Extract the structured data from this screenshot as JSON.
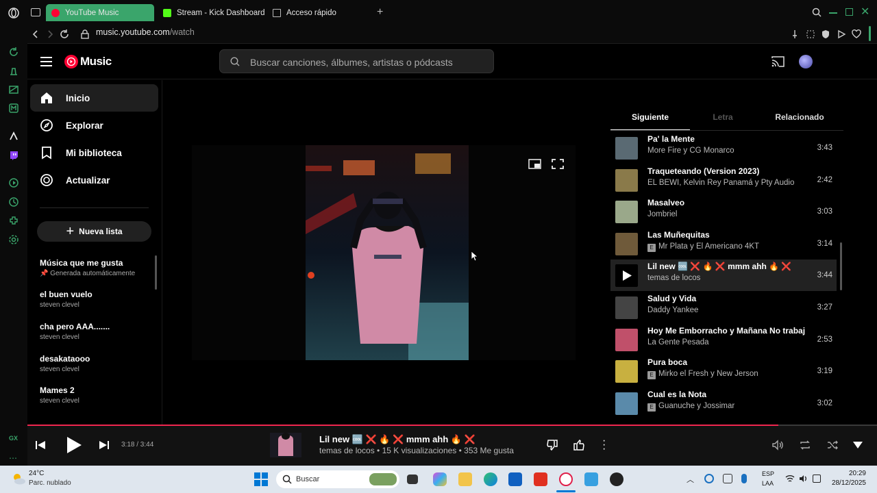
{
  "browser": {
    "tabs": [
      {
        "label": "YouTube Music",
        "active": true
      },
      {
        "label": "Stream - Kick Dashboard",
        "active": false
      },
      {
        "label": "Acceso rápido",
        "active": false
      }
    ],
    "url_host": "music.youtube.com",
    "url_path": "/watch",
    "rail_label": "GX",
    "accent": "#3aa56b"
  },
  "ytm": {
    "logo_text": "Music",
    "search_placeholder": "Buscar canciones, álbumes, artistas o pódcasts",
    "nav": [
      {
        "label": "Inicio",
        "icon": "home-icon",
        "active": true
      },
      {
        "label": "Explorar",
        "icon": "compass-icon",
        "active": false
      },
      {
        "label": "Mi biblioteca",
        "icon": "library-icon",
        "active": false
      },
      {
        "label": "Actualizar",
        "icon": "upgrade-icon",
        "active": false
      }
    ],
    "new_list_label": "Nueva lista",
    "playlists": [
      {
        "title": "Música que me gusta",
        "subtitle": "Generada automáticamente"
      },
      {
        "title": "el buen vuelo",
        "subtitle": "steven clevel"
      },
      {
        "title": "cha pero AAA.......",
        "subtitle": "steven clevel"
      },
      {
        "title": "desakataooo",
        "subtitle": "steven clevel"
      },
      {
        "title": "Mames 2",
        "subtitle": "steven clevel"
      }
    ],
    "upnext_tabs": [
      "Siguiente",
      "Letra",
      "Relacionado"
    ],
    "queue": [
      {
        "title": "Pa' la Mente",
        "artist": "More Fire y CG Monarco",
        "duration": "3:43",
        "explicit": false,
        "color": "#5a6a73"
      },
      {
        "title": "Traqueteando (Version 2023)",
        "artist": "EL BEWI, Kelvin Rey Panamá y Pty Audio",
        "duration": "2:42",
        "explicit": false,
        "color": "#8a7a4a"
      },
      {
        "title": "Masalveo",
        "artist": "Jombriel",
        "duration": "3:03",
        "explicit": false,
        "color": "#9aa88a"
      },
      {
        "title": "Las Muñequitas",
        "artist": "Mr Plata y El Americano 4KT",
        "duration": "3:14",
        "explicit": true,
        "color": "#6f5a3a"
      },
      {
        "title": "Lil new 🆒 ❌ 🔥 ❌ mmm ahh 🔥 ❌",
        "artist": "temas de locos",
        "duration": "3:44",
        "explicit": false,
        "active": true,
        "color": "#000000"
      },
      {
        "title": "Salud y Vida",
        "artist": "Daddy Yankee",
        "duration": "3:27",
        "explicit": false,
        "color": "#444444"
      },
      {
        "title": "Hoy Me Emborracho y Mañana No trabajo",
        "artist": "La Gente Pesada",
        "duration": "2:53",
        "explicit": false,
        "color": "#c0506a"
      },
      {
        "title": "Pura boca",
        "artist": "Mirko el Fresh y New Jerson",
        "duration": "3:19",
        "explicit": true,
        "color": "#c8b040"
      },
      {
        "title": "Cual es la Nota",
        "artist": "Guanuche y Jossimar",
        "duration": "3:02",
        "explicit": true,
        "color": "#5a8aaa"
      }
    ]
  },
  "player": {
    "time": "3:18 / 3:44",
    "progress": 0.884,
    "title": "Lil new 🆒 ❌ 🔥 ❌ mmm ahh 🔥 ❌",
    "meta": "temas de locos • 15 K visualizaciones • 353 Me gusta",
    "accent": "#f0264f"
  },
  "taskbar": {
    "weather_temp": "24°C",
    "weather_desc": "Parc. nublado",
    "search_label": "Buscar",
    "lang_1": "ESP",
    "lang_2": "LAA",
    "time": "20:29",
    "date": "28/12/2025"
  }
}
